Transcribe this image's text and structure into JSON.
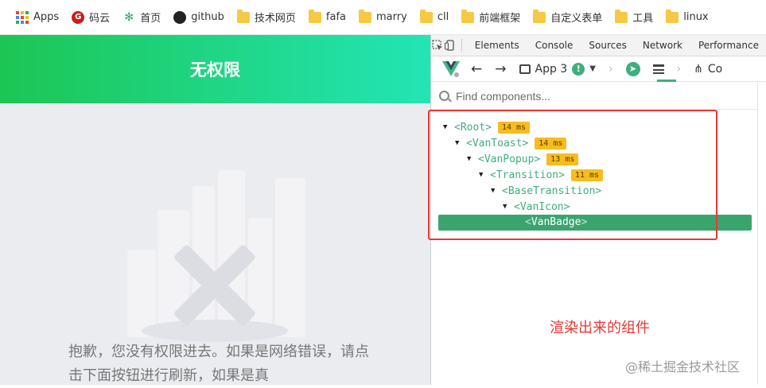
{
  "bookmarks": [
    {
      "label": "Apps",
      "icon": "apps-grid-icon"
    },
    {
      "label": "码云",
      "icon": "gitee-icon"
    },
    {
      "label": "首页",
      "icon": "home-leaf-icon"
    },
    {
      "label": "github",
      "icon": "github-icon"
    },
    {
      "label": "技术网页",
      "icon": "folder-icon"
    },
    {
      "label": "fafa",
      "icon": "folder-icon"
    },
    {
      "label": "marry",
      "icon": "folder-icon"
    },
    {
      "label": "cll",
      "icon": "folder-icon"
    },
    {
      "label": "前端框架",
      "icon": "folder-icon"
    },
    {
      "label": "自定义表单",
      "icon": "folder-icon"
    },
    {
      "label": "工具",
      "icon": "folder-icon"
    },
    {
      "label": "linux",
      "icon": "folder-icon"
    }
  ],
  "app": {
    "title": "无权限",
    "message": "抱歉，您没有权限进去。如果是网络错误，请点击下面按钮进行刷新，如果是真"
  },
  "devtools": {
    "tabs": [
      "Elements",
      "Console",
      "Sources",
      "Network",
      "Performance"
    ],
    "vue": {
      "app_name": "App 3",
      "partial_tab": "Co"
    },
    "search": {
      "placeholder": "Find components..."
    },
    "tree": [
      {
        "label": "<Root>",
        "ms": "14 ms",
        "depth": 0
      },
      {
        "label": "<VanToast>",
        "ms": "14 ms",
        "depth": 1
      },
      {
        "label": "<VanPopup>",
        "ms": "13 ms",
        "depth": 2
      },
      {
        "label": "<Transition>",
        "ms": "11 ms",
        "depth": 3
      },
      {
        "label": "<BaseTransition>",
        "ms": "",
        "depth": 4
      },
      {
        "label": "<VanIcon>",
        "ms": "",
        "depth": 5
      }
    ],
    "selected": {
      "label": "VanBadge"
    }
  },
  "annotation": "渲染出来的组件",
  "watermark": "@稀土掘金技术社区",
  "colors": {
    "vue_green": "#3eaf7c",
    "header_gradient_start": "#1cc654",
    "header_gradient_end": "#23e5b5",
    "annotation_red": "#e53935",
    "ms_badge": "#f7bc1f"
  }
}
